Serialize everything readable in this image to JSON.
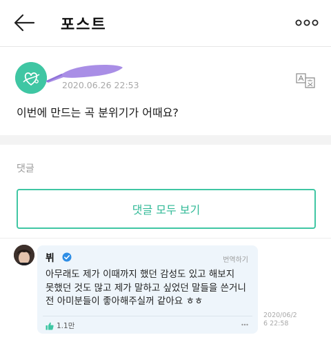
{
  "header": {
    "title": "포스트"
  },
  "post": {
    "timestamp": "2020.06.26 22:53",
    "body": "이번에 만드는 곡 분위기가 어때요?"
  },
  "comments": {
    "label": "댓글",
    "view_all_label": "댓글 모두 보기",
    "items": [
      {
        "author": "뷔",
        "translate_label": "번역하기",
        "body": "아무래도 제가 이때까지 했던 감성도 있고 해보지 못했던 것도 많고 제가 말하고 싶었던 말들을 쓴거니 전 아미분들이 좋아해주실꺼 같아요 ㅎㅎ",
        "likes": "1.1만",
        "time": "2020/06/26 22:58"
      }
    ]
  },
  "colors": {
    "accent": "#3fc6a3",
    "bubble_bg": "#eef5fb",
    "redaction": "#a98ee6"
  }
}
